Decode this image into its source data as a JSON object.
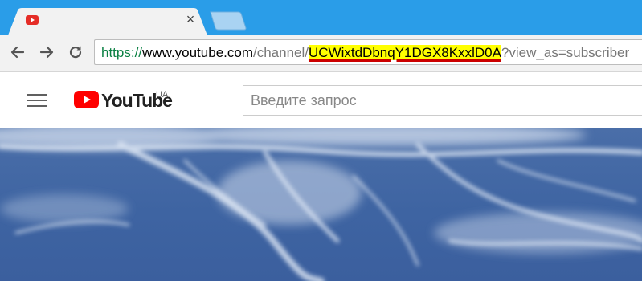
{
  "browser": {
    "tab": {
      "title": "",
      "favicon_icon": "youtube-favicon-icon",
      "close_label": "×"
    },
    "nav": {
      "back_icon": "back-arrow-icon",
      "forward_icon": "forward-arrow-icon",
      "reload_icon": "reload-icon"
    },
    "address_bar": {
      "scheme": "https://",
      "host": "www.youtube.com",
      "path_prefix": "/channel/",
      "highlighted_segment": "UCWixtdDbnqY1DGX8KxxlD0A",
      "path_suffix": "?view_as=subscriber",
      "highlight_color": "#ffff00",
      "underline_color": "#cc0000"
    },
    "colors": {
      "tabstrip": "#2a9de8",
      "toolbar": "#f2f2f2"
    }
  },
  "youtube": {
    "logo_text": "YouTube",
    "region_code": "UA",
    "search_placeholder": "Введите запрос",
    "brand_color": "#ff0000"
  },
  "banner": {
    "description_colors": [
      "#3e64a2",
      "#c9d6ec"
    ]
  }
}
